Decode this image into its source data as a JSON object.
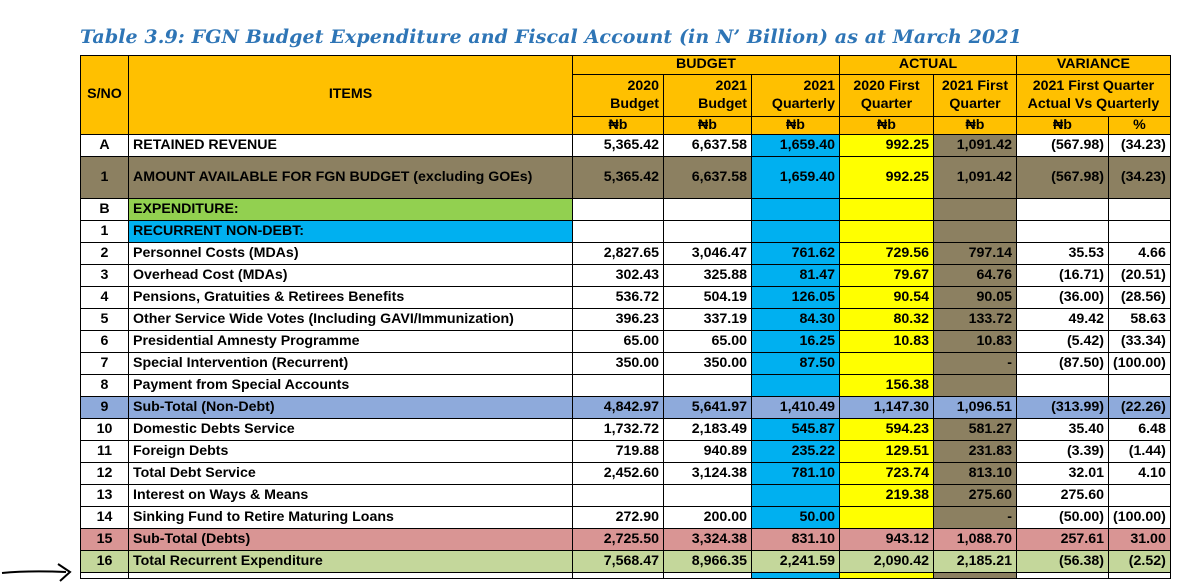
{
  "title": "Table 3.9: FGN Budget Expenditure and Fiscal Account (in N’ Billion) as at March 2021",
  "headers": {
    "sno": "S/NO",
    "items": "ITEMS",
    "budget": "BUDGET",
    "actual": "ACTUAL",
    "variance": "VARIANCE",
    "budget_2020": "2020 Budget",
    "budget_2021": "2021 Budget",
    "quarterly_2021": "2021 Quarterly",
    "actual_2020": "2020 First Quarter",
    "actual_2021": "2021 First Quarter",
    "variance_desc": "2021 First Quarter Actual Vs Quarterly"
  },
  "units": [
    "₦b",
    "₦b",
    "₦b",
    "₦b",
    "₦b",
    "₦b",
    "%"
  ],
  "rows": [
    {
      "sno": "A",
      "item": "RETAINED REVENUE",
      "vals": [
        "5,365.42",
        "6,637.58",
        "1,659.40",
        "992.25",
        "1,091.42",
        "(567.98)",
        "(34.23)"
      ]
    },
    {
      "sno": "1",
      "item": "AMOUNT AVAILABLE FOR FGN BUDGET (excluding GOEs)",
      "vals": [
        "5,365.42",
        "6,637.58",
        "1,659.40",
        "992.25",
        "1,091.42",
        "(567.98)",
        "(34.23)"
      ]
    },
    {
      "sno": "B",
      "item": "EXPENDITURE:",
      "vals": [
        "",
        "",
        "",
        "",
        "",
        "",
        ""
      ]
    },
    {
      "sno": "1",
      "item": "RECURRENT NON-DEBT:",
      "vals": [
        "",
        "",
        "",
        "",
        "",
        "",
        ""
      ]
    },
    {
      "sno": "2",
      "item": "Personnel Costs (MDAs)",
      "vals": [
        "2,827.65",
        "3,046.47",
        "761.62",
        "729.56",
        "797.14",
        "35.53",
        "4.66"
      ]
    },
    {
      "sno": "3",
      "item": "Overhead Cost (MDAs)",
      "vals": [
        "302.43",
        "325.88",
        "81.47",
        "79.67",
        "64.76",
        "(16.71)",
        "(20.51)"
      ]
    },
    {
      "sno": "4",
      "item": "Pensions, Gratuities & Retirees Benefits",
      "vals": [
        "536.72",
        "504.19",
        "126.05",
        "90.54",
        "90.05",
        "(36.00)",
        "(28.56)"
      ]
    },
    {
      "sno": "5",
      "item": "Other Service Wide Votes (Including GAVI/Immunization)",
      "vals": [
        "396.23",
        "337.19",
        "84.30",
        "80.32",
        "133.72",
        "49.42",
        "58.63"
      ]
    },
    {
      "sno": "6",
      "item": "Presidential Amnesty Programme",
      "vals": [
        "65.00",
        "65.00",
        "16.25",
        "10.83",
        "10.83",
        "(5.42)",
        "(33.34)"
      ]
    },
    {
      "sno": "7",
      "item": "Special Intervention (Recurrent)",
      "vals": [
        "350.00",
        "350.00",
        "87.50",
        "",
        "-",
        "(87.50)",
        "(100.00)"
      ]
    },
    {
      "sno": "8",
      "item": "Payment from Special Accounts",
      "vals": [
        "",
        "",
        "",
        "156.38",
        "",
        "",
        ""
      ]
    },
    {
      "sno": "9",
      "item": "Sub-Total (Non-Debt)",
      "vals": [
        "4,842.97",
        "5,641.97",
        "1,410.49",
        "1,147.30",
        "1,096.51",
        "(313.99)",
        "(22.26)"
      ]
    },
    {
      "sno": "10",
      "item": "Domestic Debts Service",
      "vals": [
        "1,732.72",
        "2,183.49",
        "545.87",
        "594.23",
        "581.27",
        "35.40",
        "6.48"
      ]
    },
    {
      "sno": "11",
      "item": "Foreign Debts",
      "vals": [
        "719.88",
        "940.89",
        "235.22",
        "129.51",
        "231.83",
        "(3.39)",
        "(1.44)"
      ]
    },
    {
      "sno": "12",
      "item": "Total Debt Service",
      "vals": [
        "2,452.60",
        "3,124.38",
        "781.10",
        "723.74",
        "813.10",
        "32.01",
        "4.10"
      ]
    },
    {
      "sno": "13",
      "item": "Interest on Ways & Means",
      "vals": [
        "",
        "",
        "",
        "219.38",
        "275.60",
        "275.60",
        ""
      ]
    },
    {
      "sno": "14",
      "item": "Sinking Fund to Retire Maturing Loans",
      "vals": [
        "272.90",
        "200.00",
        "50.00",
        "",
        "-",
        "(50.00)",
        "(100.00)"
      ]
    },
    {
      "sno": "15",
      "item": "Sub-Total (Debts)",
      "vals": [
        "2,725.50",
        "3,324.38",
        "831.10",
        "943.12",
        "1,088.70",
        "257.61",
        "31.00"
      ]
    },
    {
      "sno": "16",
      "item": "Total Recurrent Expenditure",
      "vals": [
        "7,568.47",
        "8,966.35",
        "2,241.59",
        "2,090.42",
        "2,185.21",
        "(56.38)",
        "(2.52)"
      ]
    }
  ],
  "colors": {
    "header": "#ffc000",
    "unit_row": "#b4a7d6",
    "quarterly": "#00b0f0",
    "actual_2020": "#ffff00",
    "actual_2021": "#8c8061",
    "olive_row": "#8c8061",
    "green": "#92d050",
    "subtotal_blue": "#8eaadb",
    "subtotal_red": "#d99594",
    "total_green": "#c4d79b",
    "title": "#2e75b6"
  },
  "arrow_icon": "hand-drawn-arrow"
}
